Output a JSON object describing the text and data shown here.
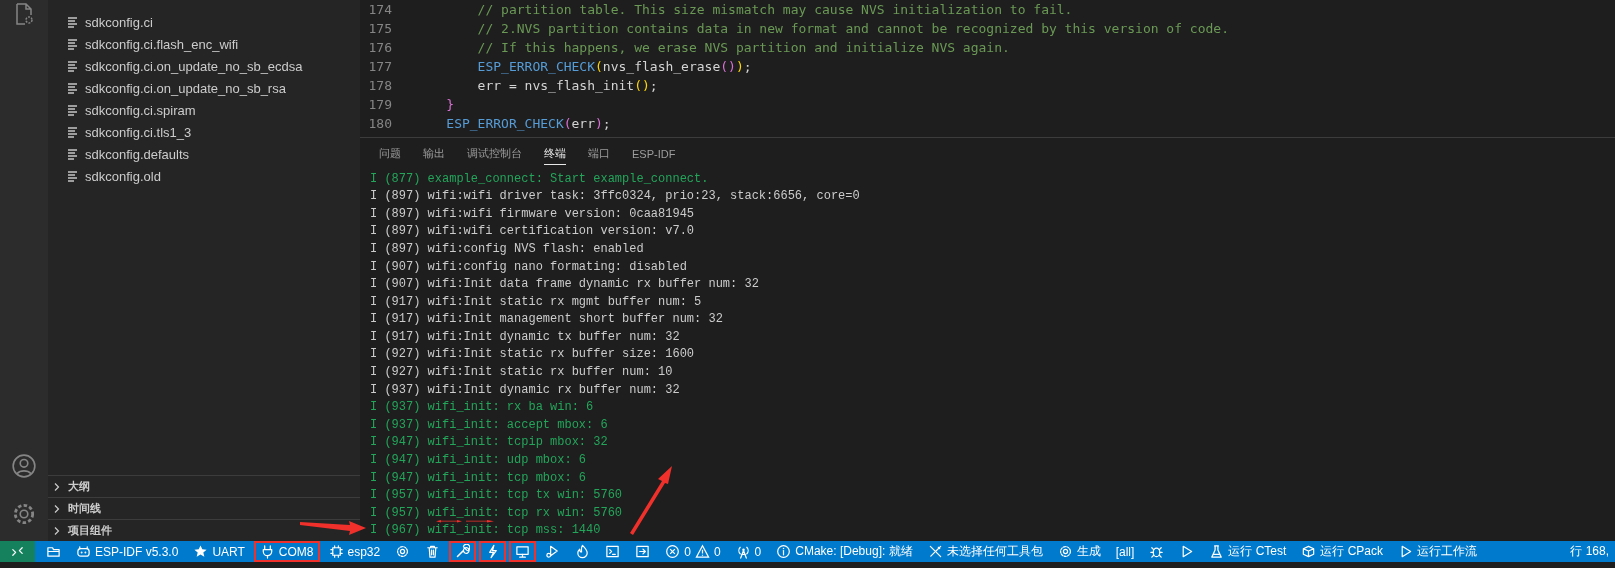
{
  "explorer": {
    "files": [
      "sdkconfig.ci",
      "sdkconfig.ci.flash_enc_wifi",
      "sdkconfig.ci.on_update_no_sb_ecdsa",
      "sdkconfig.ci.on_update_no_sb_rsa",
      "sdkconfig.ci.spiram",
      "sdkconfig.ci.tls1_3",
      "sdkconfig.defaults",
      "sdkconfig.old"
    ]
  },
  "sections": [
    {
      "label": "大纲",
      "expanded": false
    },
    {
      "label": "时间线",
      "expanded": false
    },
    {
      "label": "项目组件",
      "expanded": false
    }
  ],
  "editor": {
    "lines": [
      {
        "number": "174",
        "tokens": [
          {
            "t": "        // partition table. This size mismatch may cause NVS initialization to fail.",
            "kind": "comment"
          }
        ]
      },
      {
        "number": "175",
        "tokens": [
          {
            "t": "        // 2.NVS partition contains data in new format and cannot be recognized by this version of code.",
            "kind": "comment"
          }
        ]
      },
      {
        "number": "176",
        "tokens": [
          {
            "t": "        // If this happens, we erase NVS partition and initialize NVS again.",
            "kind": "comment"
          }
        ]
      },
      {
        "number": "177",
        "tokens": [
          {
            "t": "        ESP_ERROR_CHECK",
            "kind": "macro"
          },
          {
            "t": "(",
            "kind": "bracket"
          },
          {
            "t": "nvs_flash_erase",
            "kind": "plain"
          },
          {
            "t": "()",
            "kind": "bracket2"
          },
          {
            "t": ")",
            "kind": "bracket"
          },
          {
            "t": ";",
            "kind": "plain"
          }
        ]
      },
      {
        "number": "178",
        "tokens": [
          {
            "t": "        err = nvs_flash_init",
            "kind": "plain"
          },
          {
            "t": "()",
            "kind": "bracket"
          },
          {
            "t": ";",
            "kind": "plain"
          }
        ]
      },
      {
        "number": "179",
        "tokens": [
          {
            "t": "    }",
            "kind": "bracket2"
          }
        ]
      },
      {
        "number": "180",
        "tokens": [
          {
            "t": "    ESP_ERROR_CHECK",
            "kind": "macro"
          },
          {
            "t": "(",
            "kind": "bracket2"
          },
          {
            "t": "err",
            "kind": "plain"
          },
          {
            "t": ")",
            "kind": "bracket2"
          },
          {
            "t": ";",
            "kind": "plain"
          }
        ]
      }
    ]
  },
  "panel": {
    "tabs": [
      {
        "label": "问题",
        "selected": false
      },
      {
        "label": "输出",
        "selected": false
      },
      {
        "label": "调试控制台",
        "selected": false
      },
      {
        "label": "终端",
        "selected": true
      },
      {
        "label": "端口",
        "selected": false
      },
      {
        "label": "ESP-IDF",
        "selected": false
      }
    ],
    "terminal": [
      {
        "text": "I (877) example_connect: Start example_connect.",
        "kind": "info"
      },
      {
        "text": "I (897) wifi:wifi driver task: 3ffc0324, prio:23, stack:6656, core=0",
        "kind": "plain"
      },
      {
        "text": "I (897) wifi:wifi firmware version: 0caa81945",
        "kind": "plain"
      },
      {
        "text": "I (897) wifi:wifi certification version: v7.0",
        "kind": "plain"
      },
      {
        "text": "I (897) wifi:config NVS flash: enabled",
        "kind": "plain"
      },
      {
        "text": "I (907) wifi:config nano formating: disabled",
        "kind": "plain"
      },
      {
        "text": "I (907) wifi:Init data frame dynamic rx buffer num: 32",
        "kind": "plain"
      },
      {
        "text": "I (917) wifi:Init static rx mgmt buffer num: 5",
        "kind": "plain"
      },
      {
        "text": "I (917) wifi:Init management short buffer num: 32",
        "kind": "plain"
      },
      {
        "text": "I (917) wifi:Init dynamic tx buffer num: 32",
        "kind": "plain"
      },
      {
        "text": "I (927) wifi:Init static rx buffer size: 1600",
        "kind": "plain"
      },
      {
        "text": "I (927) wifi:Init static rx buffer num: 10",
        "kind": "plain"
      },
      {
        "text": "I (937) wifi:Init dynamic rx buffer num: 32",
        "kind": "plain"
      },
      {
        "text": "I (937) wifi_init: rx ba win: 6",
        "kind": "info"
      },
      {
        "text": "I (937) wifi_init: accept mbox: 6",
        "kind": "info"
      },
      {
        "text": "I (947) wifi_init: tcpip mbox: 32",
        "kind": "info"
      },
      {
        "text": "I (947) wifi_init: udp mbox: 6",
        "kind": "info"
      },
      {
        "text": "I (947) wifi_init: tcp mbox: 6",
        "kind": "info"
      },
      {
        "text": "I (957) wifi_init: tcp tx win: 5760",
        "kind": "info"
      },
      {
        "text": "I (957) wifi_init: tcp rx win: 5760",
        "kind": "info"
      },
      {
        "text": "I (967) wifi_init: tcp mss: 1440",
        "kind": "info"
      }
    ]
  },
  "status_bar": {
    "items": [
      {
        "kind": "remote",
        "highlighted": false
      },
      {
        "kind": "explorer",
        "highlighted": false
      },
      {
        "kind": "idf",
        "text": "ESP-IDF v5.3.0",
        "highlighted": false
      },
      {
        "kind": "uart",
        "text": "UART",
        "highlighted": false
      },
      {
        "kind": "port",
        "text": "COM8",
        "highlighted": true
      },
      {
        "kind": "target",
        "text": "esp32",
        "highlighted": false
      },
      {
        "kind": "settings",
        "highlighted": false
      },
      {
        "kind": "clean",
        "highlighted": false
      },
      {
        "kind": "build",
        "highlighted": true
      },
      {
        "kind": "flash",
        "highlighted": true
      },
      {
        "kind": "monitor",
        "highlighted": true
      },
      {
        "kind": "debug",
        "highlighted": false
      },
      {
        "kind": "flame",
        "highlighted": false
      },
      {
        "kind": "terminal",
        "highlighted": false
      },
      {
        "kind": "open",
        "highlighted": false
      },
      {
        "kind": "problems",
        "errors": "0",
        "warnings": "0",
        "highlighted": false
      },
      {
        "kind": "ports",
        "text": "0",
        "highlighted": false
      },
      {
        "kind": "cmake",
        "text": "CMake: [Debug]: 就绪",
        "highlighted": false
      },
      {
        "kind": "kit",
        "text": "未选择任何工具包",
        "highlighted": false
      },
      {
        "kind": "generate",
        "text": "生成",
        "highlighted": false
      },
      {
        "kind": "target-all",
        "text": "[all]",
        "highlighted": false
      },
      {
        "kind": "bug",
        "highlighted": false
      },
      {
        "kind": "run",
        "highlighted": false
      },
      {
        "kind": "ctest",
        "text": "运行 CTest",
        "highlighted": false
      },
      {
        "kind": "cpack",
        "text": "运行 CPack",
        "highlighted": false
      },
      {
        "kind": "workflow",
        "text": "运行工作流",
        "highlighted": false
      },
      {
        "kind": "position",
        "text": "行 168,",
        "highlighted": false
      }
    ]
  }
}
